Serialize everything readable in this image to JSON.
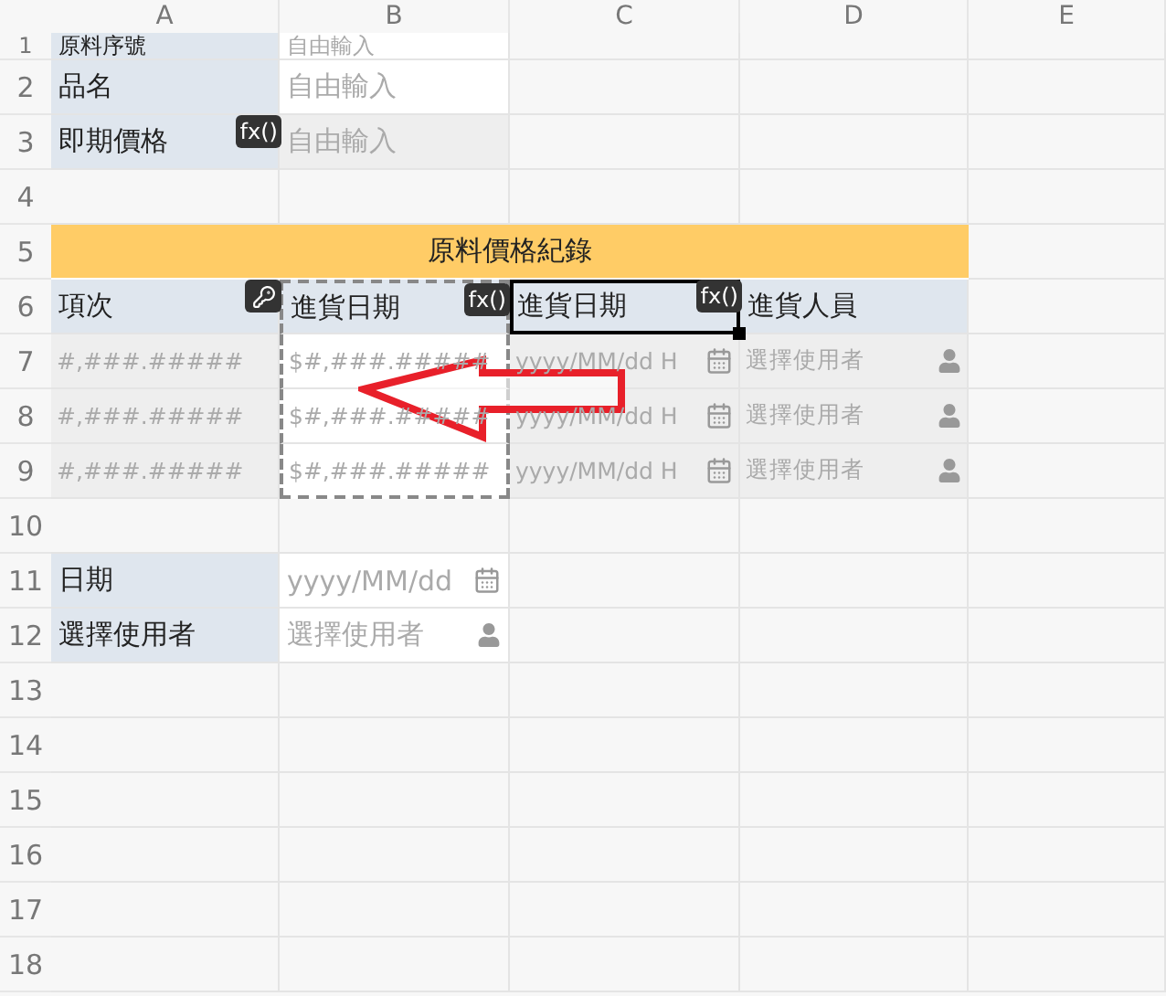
{
  "column_headers": [
    "A",
    "B",
    "C",
    "D",
    "E"
  ],
  "row_numbers": [
    "1",
    "2",
    "3",
    "4",
    "5",
    "6",
    "7",
    "8",
    "9",
    "10",
    "11",
    "12",
    "13",
    "14",
    "15",
    "16",
    "17",
    "18"
  ],
  "top_fields": [
    {
      "label": "原料序號",
      "placeholder": "自由輸入",
      "readonly": false
    },
    {
      "label": "品名",
      "placeholder": "自由輸入",
      "readonly": false
    },
    {
      "label": "即期價格",
      "placeholder": "自由輸入",
      "readonly": true,
      "badge": "fx()"
    }
  ],
  "table": {
    "title": "原料價格紀錄",
    "columns": [
      {
        "header": "項次",
        "key": true,
        "readonly": true,
        "copied": false,
        "selected": false,
        "kind": "number"
      },
      {
        "header": "進貨日期",
        "badge": "fx()",
        "readonly": false,
        "copied": true,
        "selected": false,
        "kind": "currency"
      },
      {
        "header": "進貨日期",
        "badge": "fx()",
        "readonly": true,
        "copied": false,
        "selected": true,
        "kind": "date"
      },
      {
        "header": "進貨人員",
        "readonly": true,
        "copied": false,
        "selected": false,
        "kind": "user"
      }
    ],
    "rows": [
      [
        "#,###.#####",
        "$#,###.#####",
        "yyyy/MM/dd H",
        "選擇使用者"
      ],
      [
        "#,###.#####",
        "$#,###.#####",
        "yyyy/MM/dd H",
        "選擇使用者"
      ],
      [
        "#,###.#####",
        "$#,###.#####",
        "yyyy/MM/dd H",
        "選擇使用者"
      ]
    ]
  },
  "bottom_fields": [
    {
      "label": "日期",
      "placeholder": "yyyy/MM/dd",
      "readonly": false,
      "kind": "date"
    },
    {
      "label": "選擇使用者",
      "placeholder": "選擇使用者",
      "readonly": false,
      "kind": "user"
    }
  ],
  "annotation": {
    "kind": "arrow"
  }
}
